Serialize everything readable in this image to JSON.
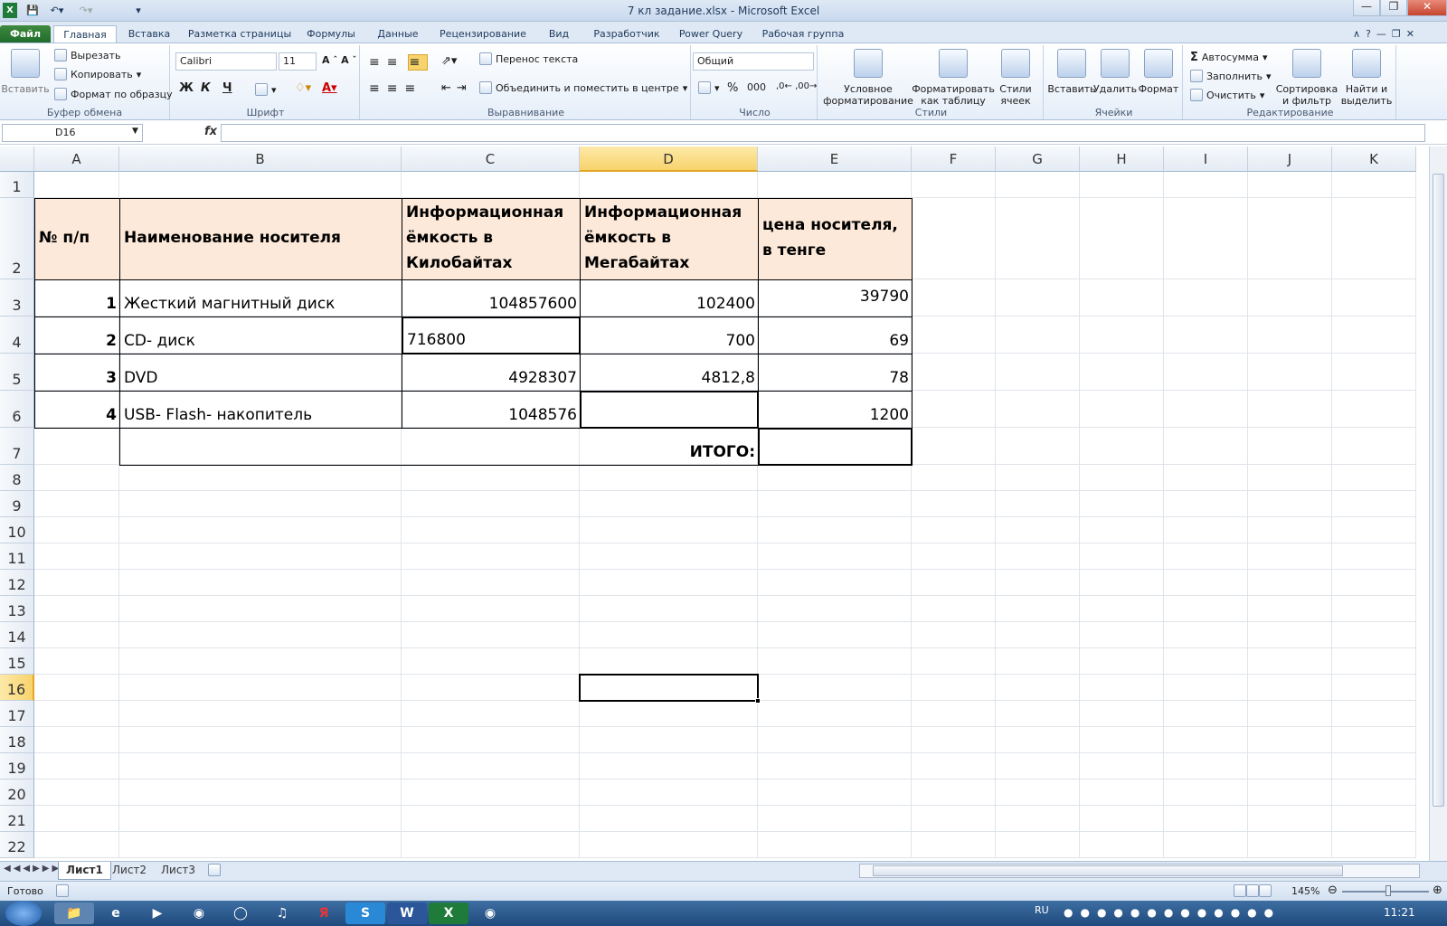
{
  "window": {
    "title": "7 кл задание.xlsx  -  Microsoft Excel",
    "app_icon": "excel-icon"
  },
  "tabs": [
    "Файл",
    "Главная",
    "Вставка",
    "Разметка страницы",
    "Формулы",
    "Данные",
    "Рецензирование",
    "Вид",
    "Разработчик",
    "Power Query",
    "Рабочая группа"
  ],
  "ribbon": {
    "clipboard": {
      "label": "Буфер обмена",
      "paste": "Вставить",
      "cut": "Вырезать",
      "copy": "Копировать",
      "format_painter": "Формат по образцу"
    },
    "font": {
      "label": "Шрифт",
      "font_name": "Calibri",
      "font_size": "11",
      "bold": "Ж",
      "italic": "К",
      "underline": "Ч"
    },
    "alignment": {
      "label": "Выравнивание",
      "wrap_text": "Перенос текста",
      "merge_center": "Объединить и поместить в центре"
    },
    "number": {
      "label": "Число",
      "format": "Общий",
      "percent": "%",
      "thousands": "000"
    },
    "styles": {
      "label": "Стили",
      "conditional": "Условное\nформатирование",
      "format_table": "Форматировать\nкак таблицу",
      "cell_styles": "Стили\nячеек"
    },
    "cells": {
      "label": "Ячейки",
      "insert": "Вставить",
      "delete": "Удалить",
      "format": "Формат"
    },
    "editing": {
      "label": "Редактирование",
      "autosum": "Автосумма",
      "fill": "Заполнить",
      "clear": "Очистить",
      "sort": "Сортировка\nи фильтр",
      "find": "Найти и\nвыделить"
    }
  },
  "formula_bar": {
    "name_box": "D16",
    "fx": "fx",
    "value": ""
  },
  "columns": [
    "A",
    "B",
    "C",
    "D",
    "E",
    "F",
    "G",
    "H",
    "I",
    "J",
    "K"
  ],
  "rows": [
    "1",
    "2",
    "3",
    "4",
    "5",
    "6",
    "7",
    "8",
    "9",
    "10",
    "11",
    "12",
    "13",
    "14",
    "15",
    "16",
    "17",
    "18",
    "19",
    "20",
    "21",
    "22"
  ],
  "selected_cell": "D16",
  "table": {
    "headers": {
      "a": "№ п/п",
      "b": "Наименование носителя",
      "c1": "Информационная",
      "c2": "ёмкость в",
      "c3": "Килобайтах",
      "d1": "Информационная",
      "d2": "ёмкость в",
      "d3": "Мегабайтах",
      "e1": "цена носителя,",
      "e2": "в тенге"
    },
    "rows": [
      {
        "n": "1",
        "name": "Жесткий магнитный диск",
        "kb": "104857600",
        "mb": "102400",
        "price": "39790"
      },
      {
        "n": "2",
        "name": "CD- диск",
        "kb": "716800",
        "mb": "700",
        "price": "69"
      },
      {
        "n": "3",
        "name": "DVD",
        "kb": "4928307",
        "mb": "4812,8",
        "price": "78"
      },
      {
        "n": "4",
        "name": "USB- Flash- накопитель",
        "kb": "1048576",
        "mb": "",
        "price": "1200"
      }
    ],
    "total_label": "ИТОГО:"
  },
  "sheets": [
    "Лист1",
    "Лист2",
    "Лист3"
  ],
  "status": {
    "ready": "Готово",
    "zoom": "145%"
  },
  "taskbar": {
    "lang": "RU",
    "time": "11:21"
  },
  "colors": {
    "header_fill": "#fde9d9",
    "selected_header": "#f7d36b",
    "file_tab": "#1e6b2b"
  }
}
